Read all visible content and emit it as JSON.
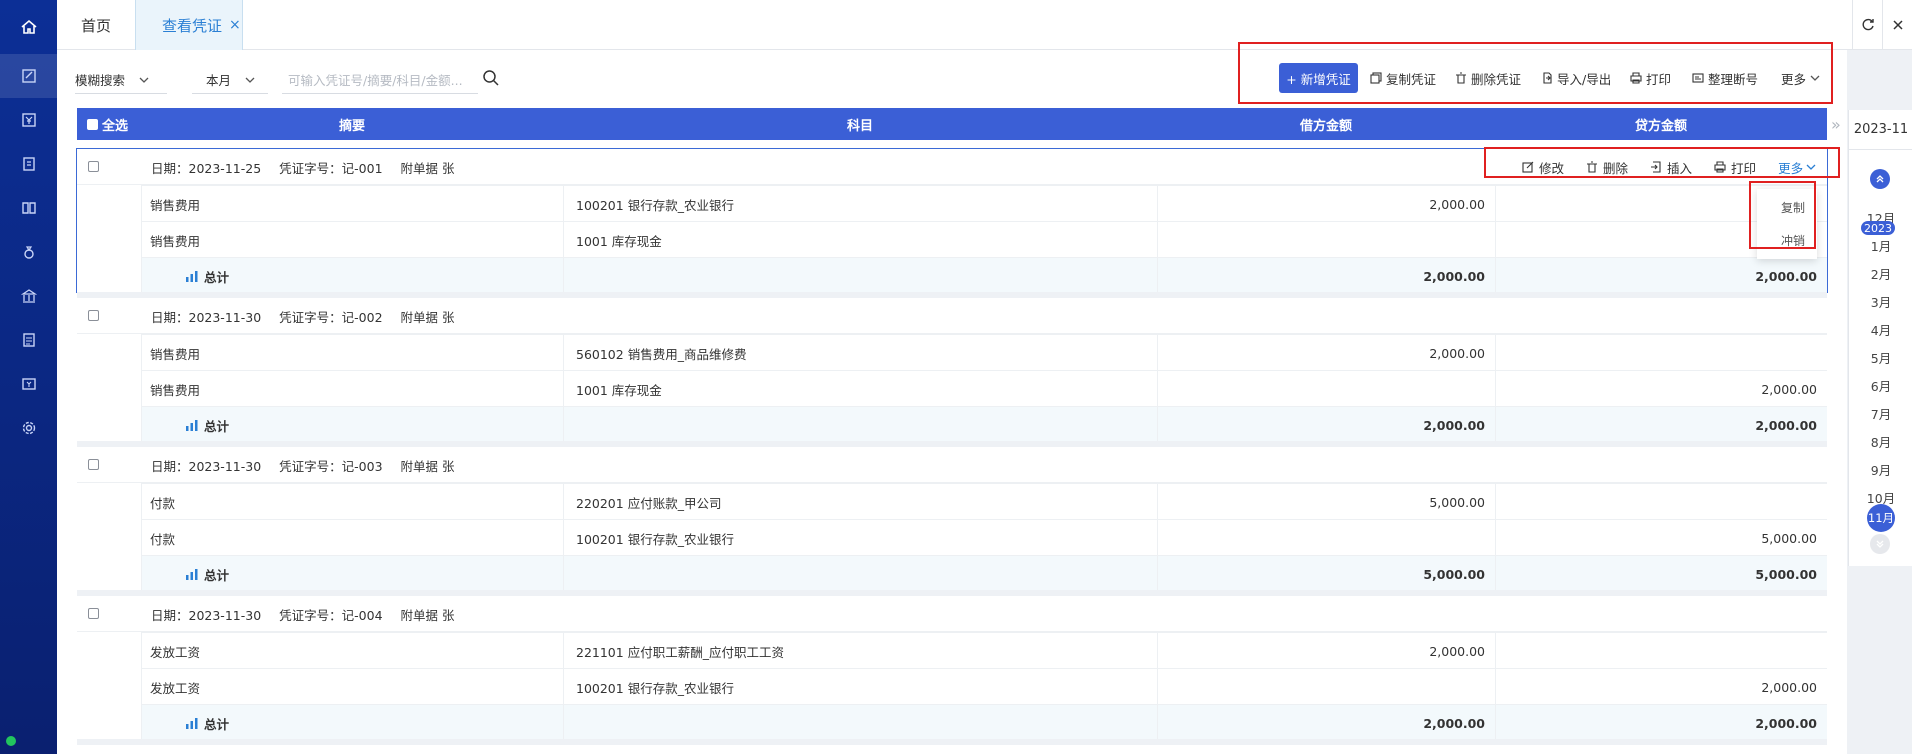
{
  "colors": {
    "primary": "#3b5fd6",
    "rail": "#0c2f96",
    "highlight": "#e02020",
    "link": "#2a7fd4"
  },
  "rail": {
    "icons": [
      "home-icon",
      "voucher-icon",
      "yen-icon",
      "ledger-icon",
      "book-icon",
      "money-bag-icon",
      "bank-icon",
      "report-icon",
      "tax-icon",
      "gear-icon"
    ]
  },
  "tabs": {
    "home": "首页",
    "active": "查看凭证",
    "close": "×"
  },
  "toolbar": {
    "search_mode": "模糊搜索",
    "period": "本月",
    "search_placeholder": "可输入凭证号/摘要/科目/金额...",
    "new_voucher": "+ 新增凭证",
    "copy_voucher": "复制凭证",
    "delete_voucher": "删除凭证",
    "import_export": "导入/导出",
    "print": "打印",
    "renumber": "整理断号",
    "more": "更多"
  },
  "table": {
    "headers": {
      "select_all": "全选",
      "summary": "摘要",
      "account": "科目",
      "debit": "借方金额",
      "credit": "贷方金额"
    }
  },
  "row_actions": {
    "edit": "修改",
    "delete": "删除",
    "insert": "插入",
    "print": "打印",
    "more": "更多"
  },
  "more_menu": {
    "copy": "复制",
    "reverse": "冲销"
  },
  "vouchers": [
    {
      "date": "日期：2023-11-25",
      "number": "凭证字号：记-001",
      "attach": "附单据  张",
      "lines": [
        {
          "summary": "销售费用",
          "account": "100201  银行存款_农业银行",
          "debit": "2,000.00",
          "credit": ""
        },
        {
          "summary": "销售费用",
          "account": "1001  库存现金",
          "debit": "",
          "credit": ""
        }
      ],
      "total_label": "总计",
      "total_debit": "2,000.00",
      "total_credit": "2,000.00"
    },
    {
      "date": "日期：2023-11-30",
      "number": "凭证字号：记-002",
      "attach": "附单据  张",
      "lines": [
        {
          "summary": "销售费用",
          "account": "560102  销售费用_商品维修费",
          "debit": "2,000.00",
          "credit": ""
        },
        {
          "summary": "销售费用",
          "account": "1001  库存现金",
          "debit": "",
          "credit": "2,000.00"
        }
      ],
      "total_label": "总计",
      "total_debit": "2,000.00",
      "total_credit": "2,000.00"
    },
    {
      "date": "日期：2023-11-30",
      "number": "凭证字号：记-003",
      "attach": "附单据  张",
      "lines": [
        {
          "summary": "付款",
          "account": "220201  应付账款_甲公司",
          "debit": "5,000.00",
          "credit": ""
        },
        {
          "summary": "付款",
          "account": "100201  银行存款_农业银行",
          "debit": "",
          "credit": "5,000.00"
        }
      ],
      "total_label": "总计",
      "total_debit": "5,000.00",
      "total_credit": "5,000.00"
    },
    {
      "date": "日期：2023-11-30",
      "number": "凭证字号：记-004",
      "attach": "附单据  张",
      "lines": [
        {
          "summary": "发放工资",
          "account": "221101  应付职工薪酬_应付职工工资",
          "debit": "2,000.00",
          "credit": ""
        },
        {
          "summary": "发放工资",
          "account": "100201  银行存款_农业银行",
          "debit": "",
          "credit": "2,000.00"
        }
      ],
      "total_label": "总计",
      "total_debit": "2,000.00",
      "total_credit": "2,000.00"
    }
  ],
  "timeline": {
    "current": "2023-11",
    "year_badge": "2023",
    "months": [
      "12月",
      "1月",
      "2月",
      "3月",
      "4月",
      "5月",
      "6月",
      "7月",
      "8月",
      "9月",
      "10月",
      "11月"
    ],
    "active_month": "11月"
  }
}
